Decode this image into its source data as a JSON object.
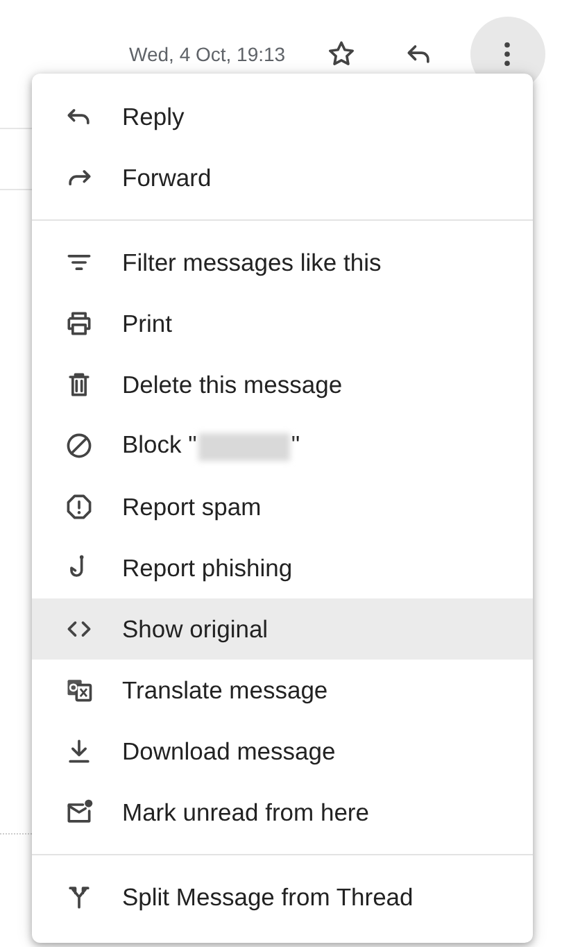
{
  "header": {
    "date": "Wed, 4 Oct, 19:13",
    "more_button": {
      "selected": true
    }
  },
  "menu": {
    "sections": [
      {
        "items": [
          {
            "label": "Reply",
            "selected": false
          },
          {
            "label": "Forward",
            "selected": false
          }
        ]
      },
      {
        "items": [
          {
            "label": "Filter messages like this",
            "selected": false
          },
          {
            "label": "Print",
            "selected": false
          },
          {
            "label": "Delete this message",
            "selected": false
          },
          {
            "label": "Block \"",
            "redacted": true,
            "label_end": "\"",
            "selected": false
          },
          {
            "label": "Report spam",
            "selected": false
          },
          {
            "label": "Report phishing",
            "selected": false
          },
          {
            "label": "Show original",
            "selected": true
          },
          {
            "label": "Translate message",
            "selected": false
          },
          {
            "label": "Download message",
            "selected": false
          },
          {
            "label": "Mark unread from here",
            "selected": false
          }
        ]
      },
      {
        "items": [
          {
            "label": "Split Message from Thread",
            "selected": false
          }
        ]
      }
    ]
  }
}
